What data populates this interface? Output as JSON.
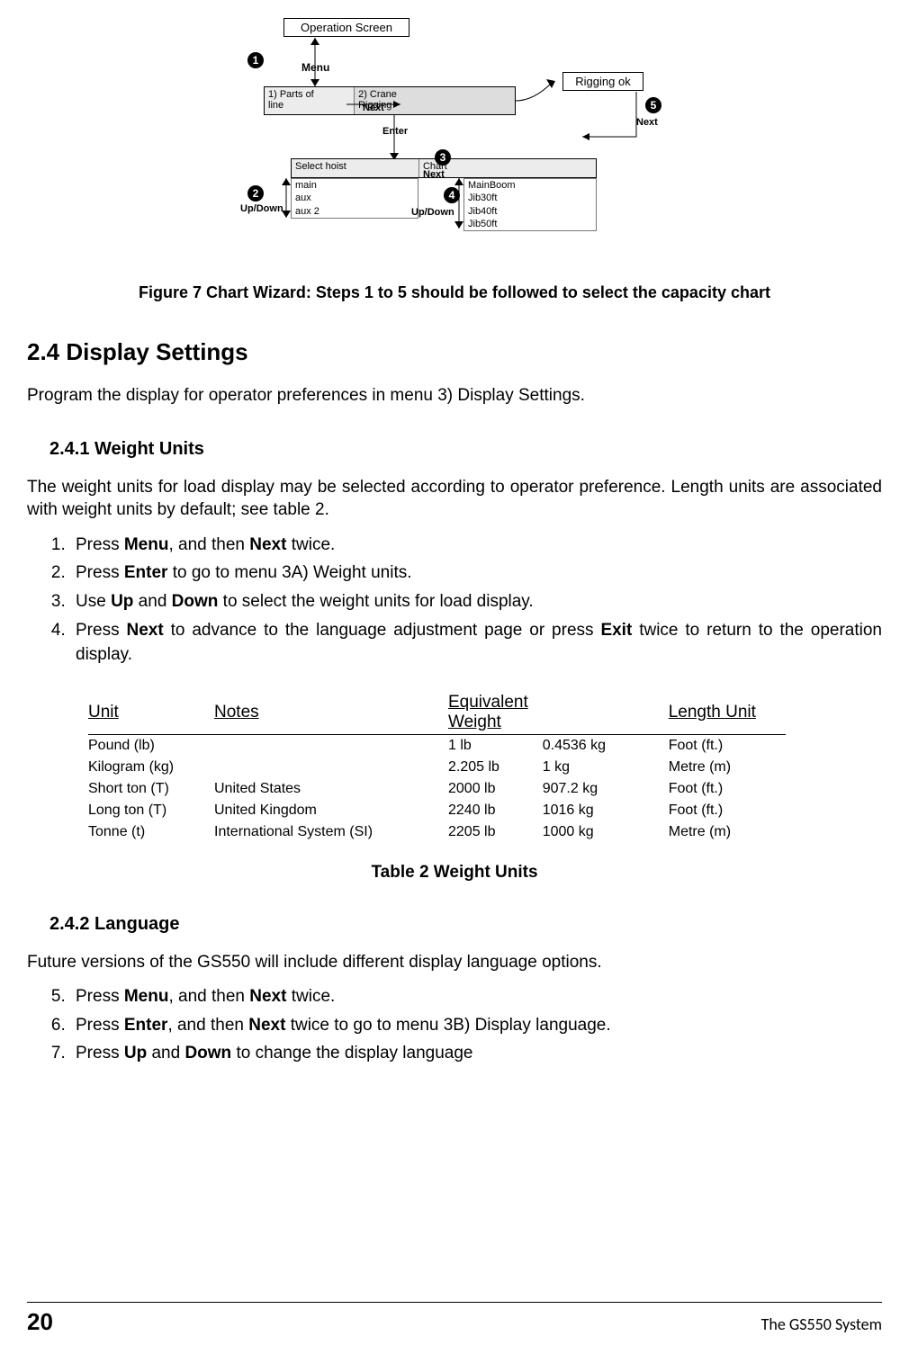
{
  "diagram": {
    "operation_screen": "Operation Screen",
    "menu_label": "Menu",
    "enter_label": "Enter",
    "rigging_ok": "Rigging ok",
    "next_label": "Next",
    "updown_label": "Up/Down",
    "row1": {
      "cell1_line1": "1) Parts of",
      "cell1_line2": "line",
      "cell2_line1": "2) Crane",
      "cell2_line2": "Rigging"
    },
    "row2_left_header": "Select hoist",
    "row2_left_items": [
      "main",
      "aux",
      "aux 2"
    ],
    "row2_right_header": "Chart",
    "row2_right_items": [
      "MainBoom",
      "Jib30ft",
      "Jib40ft",
      "Jib50ft"
    ],
    "circles": [
      "1",
      "2",
      "3",
      "4",
      "5"
    ]
  },
  "figure_caption": "Figure 7  Chart Wizard:  Steps 1 to 5 should be followed to select the capacity chart",
  "section_2_4": {
    "heading": "2.4 Display Settings",
    "intro": "Program the display for operator preferences in menu 3) Display Settings."
  },
  "section_2_4_1": {
    "heading": "2.4.1 Weight Units",
    "intro": "The weight units for load display may be selected according to operator preference. Length units are associated with weight units by default; see table 2.",
    "steps": [
      {
        "pre": "Press ",
        "b1": "Menu",
        "mid": ", and then ",
        "b2": "Next",
        "post": " twice."
      },
      {
        "pre": "Press ",
        "b1": "Enter",
        "mid": " to go to menu 3A) Weight units.",
        "b2": "",
        "post": ""
      },
      {
        "pre": "Use ",
        "b1": "Up",
        "mid": " and ",
        "b2": "Down",
        "post": " to select the weight units for load display."
      },
      {
        "pre": "Press ",
        "b1": "Next",
        "mid": " to advance to the language adjustment page or press ",
        "b2": "Exit",
        "post": " twice to return to the operation display."
      }
    ]
  },
  "table2": {
    "headers": [
      "Unit",
      "Notes",
      "Equivalent Weight",
      "",
      "Length Unit"
    ],
    "rows": [
      [
        "Pound (lb)",
        "",
        "1 lb",
        "0.4536 kg",
        "Foot (ft.)"
      ],
      [
        "Kilogram (kg)",
        "",
        "2.205 lb",
        "1 kg",
        "Metre (m)"
      ],
      [
        "Short ton (T)",
        "United States",
        "2000 lb",
        "907.2 kg",
        "Foot (ft.)"
      ],
      [
        "Long ton (T)",
        "United Kingdom",
        "2240 lb",
        "1016 kg",
        "Foot (ft.)"
      ],
      [
        "Tonne (t)",
        "International System (SI)",
        "2205 lb",
        "1000 kg",
        "Metre (m)"
      ]
    ],
    "caption": "Table 2  Weight Units"
  },
  "section_2_4_2": {
    "heading": "2.4.2 Language",
    "intro": "Future versions of the GS550 will include different display language options.",
    "steps": [
      {
        "n": "5",
        "pre": "Press ",
        "b1": "Menu",
        "mid": ", and then ",
        "b2": "Next",
        "post": " twice."
      },
      {
        "n": "6",
        "pre": "Press ",
        "b1": "Enter",
        "mid": ", and then ",
        "b2": "Next",
        "post": " twice to go to menu 3B) Display language."
      },
      {
        "n": "7",
        "pre": "Press ",
        "b1": "Up",
        "mid": " and ",
        "b2": "Down",
        "post": " to change the display language"
      }
    ]
  },
  "footer": {
    "page_number": "20",
    "title": "The GS550 System"
  }
}
